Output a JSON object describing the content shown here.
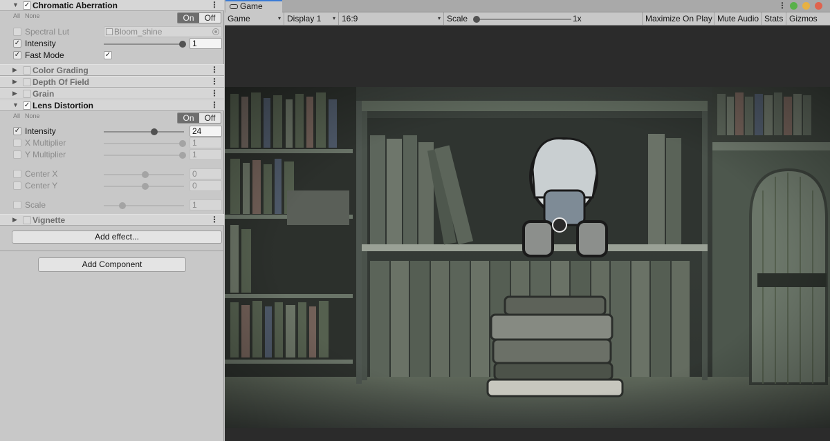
{
  "inspector": {
    "chromatic": {
      "title": "Chromatic Aberration",
      "all": "All",
      "none": "None",
      "on": "On",
      "off": "Off",
      "spectral_lut": {
        "label": "Spectral Lut",
        "value": "Bloom_shine"
      },
      "intensity": {
        "label": "Intensity",
        "value": "1",
        "level": 1.0
      },
      "fast_mode": {
        "label": "Fast Mode",
        "checked": true
      }
    },
    "color_grading": {
      "title": "Color Grading"
    },
    "depth_of_field": {
      "title": "Depth Of Field"
    },
    "grain": {
      "title": "Grain"
    },
    "lens_distortion": {
      "title": "Lens Distortion",
      "all": "All",
      "none": "None",
      "on": "On",
      "off": "Off",
      "intensity": {
        "label": "Intensity",
        "value": "24"
      },
      "x_multiplier": {
        "label": "X Multiplier",
        "value": "1"
      },
      "y_multiplier": {
        "label": "Y Multiplier",
        "value": "1"
      },
      "center_x": {
        "label": "Center X",
        "value": "0"
      },
      "center_y": {
        "label": "Center Y",
        "value": "0"
      },
      "scale": {
        "label": "Scale",
        "value": "1"
      }
    },
    "vignette": {
      "title": "Vignette"
    },
    "add_effect": "Add effect...",
    "add_component": "Add Component",
    "check_glyph": "✓",
    "fold_glyph_collapsed": "▶",
    "fold_glyph_expanded": "▼",
    "menu_glyph": "⋮"
  },
  "game": {
    "tab_label": "Game",
    "toolbar": {
      "view_select": "Game",
      "display_select": "Display 1",
      "aspect_select": "16:9",
      "scale_label": "Scale",
      "scale_value": "1x",
      "maximize_on_play": "Maximize On Play",
      "mute_audio": "Mute Audio",
      "stats": "Stats",
      "gizmos": "Gizmos"
    },
    "window_dots": [
      "#59b14a",
      "#e7b142",
      "#e0634e"
    ],
    "caret": "▾"
  }
}
